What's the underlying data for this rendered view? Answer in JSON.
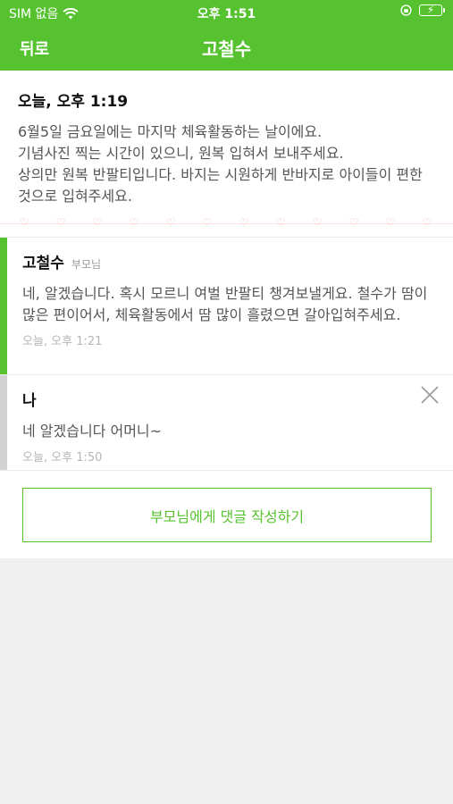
{
  "status_bar": {
    "carrier": "SIM 없음",
    "time": "오후 1:51"
  },
  "nav": {
    "back_label": "뒤로",
    "title": "고철수"
  },
  "post": {
    "date": "오늘, 오후 1:19",
    "body": "6월5일 금요일에는 마지막 체육활동하는 날이에요.\n기념사진 찍는 시간이 있으니, 원복 입혀서 보내주세요.\n상의만 원복 반팔티입니다. 바지는 시원하게 반바지로 아이들이 편한것으로 입혀주세요."
  },
  "comments": [
    {
      "name": "고철수",
      "role": "부모님",
      "text": "네, 알겠습니다. 혹시 모르니 여벌 반팔티 챙겨보낼게요. 철수가 땀이 많은 편이어서, 체육활동에서 땀 많이 흘렸으면 갈아입혀주세요.",
      "time": "오늘, 오후 1:21"
    },
    {
      "name": "나",
      "role": "",
      "text": "네 알겠습니다 어머니~",
      "time": "오늘, 오후 1:50"
    }
  ],
  "reply_button_label": "부모님에게 댓글 작성하기",
  "colors": {
    "accent": "#56c22f",
    "heart": "#f3b8b3",
    "muted_bar": "#d3d3d3"
  },
  "icons": {
    "wifi": "wifi-icon",
    "orientation_lock": "orientation-lock-icon",
    "battery": "battery-charging-icon",
    "close": "close-icon",
    "divider_heart": "heart-icon"
  }
}
